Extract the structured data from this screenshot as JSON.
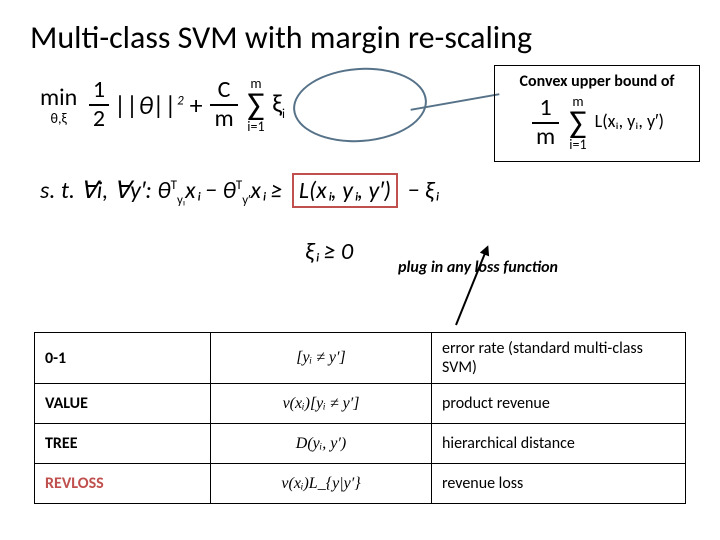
{
  "title": "Multi-class SVM with margin re-scaling",
  "objective": {
    "min": "min",
    "minsub": "θ,ξ",
    "half_num": "1",
    "half_den": "2",
    "theta_sq": "||θ||",
    "theta_exp": "2",
    "plus": " + ",
    "C_num": "C",
    "C_den": "m",
    "sum_top": "m",
    "sum_sigma": "∑",
    "sum_bot": "i=1",
    "xi": "ξ",
    "xi_sub": "i"
  },
  "box": {
    "title": "Convex upper bound of",
    "frac_num": "1",
    "frac_den": "m",
    "sum_top": "m",
    "sum_sigma": "∑",
    "sum_bot": "i=1",
    "loss": "L(xᵢ, yᵢ, y′)"
  },
  "constraint": {
    "st": "s. t. ∀i, ∀y′:  θ",
    "sup1": "T",
    "sub1": "yᵢ",
    "xi1": "xᵢ − θ",
    "sup2": "T",
    "sub2": "y′",
    "xi2": "xᵢ ≥ ",
    "loss": "L(xᵢ, yᵢ, y′)",
    "tail": " − ξᵢ"
  },
  "xi_nonneg": "ξᵢ ≥ 0",
  "plug": "plug in any loss function",
  "table": {
    "rows": [
      {
        "c1": "0-1",
        "c2": "[yᵢ ≠ y′]",
        "c3": "error rate (standard multi-class SVM)",
        "red": false
      },
      {
        "c1": "VALUE",
        "c2": "v(xᵢ)[yᵢ ≠ y′]",
        "c3": "product revenue",
        "red": false
      },
      {
        "c1": "TREE",
        "c2": "D(yᵢ, y′)",
        "c3": "hierarchical distance",
        "red": false
      },
      {
        "c1": "REVLOSS",
        "c2": "v(xᵢ)L_{y|y′}",
        "c3": "revenue loss",
        "red": true
      }
    ]
  }
}
